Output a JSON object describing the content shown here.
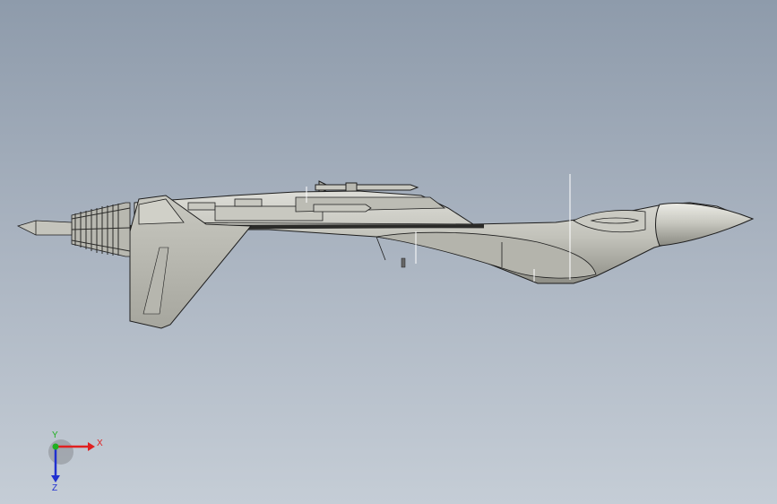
{
  "viewport": {
    "background_top": "#8e9bab",
    "background_bottom": "#c5cdd6"
  },
  "model": {
    "name_icon": "fighter-jet-model",
    "body_color": "#c2c2ba",
    "shade_color": "#9a9a92",
    "edge_color": "#1e1e1e"
  },
  "triad": {
    "x_label": "X",
    "y_label": "Y",
    "z_label": "Z",
    "x_color": "#e02020",
    "y_color": "#20b020",
    "z_color": "#2030d0"
  }
}
